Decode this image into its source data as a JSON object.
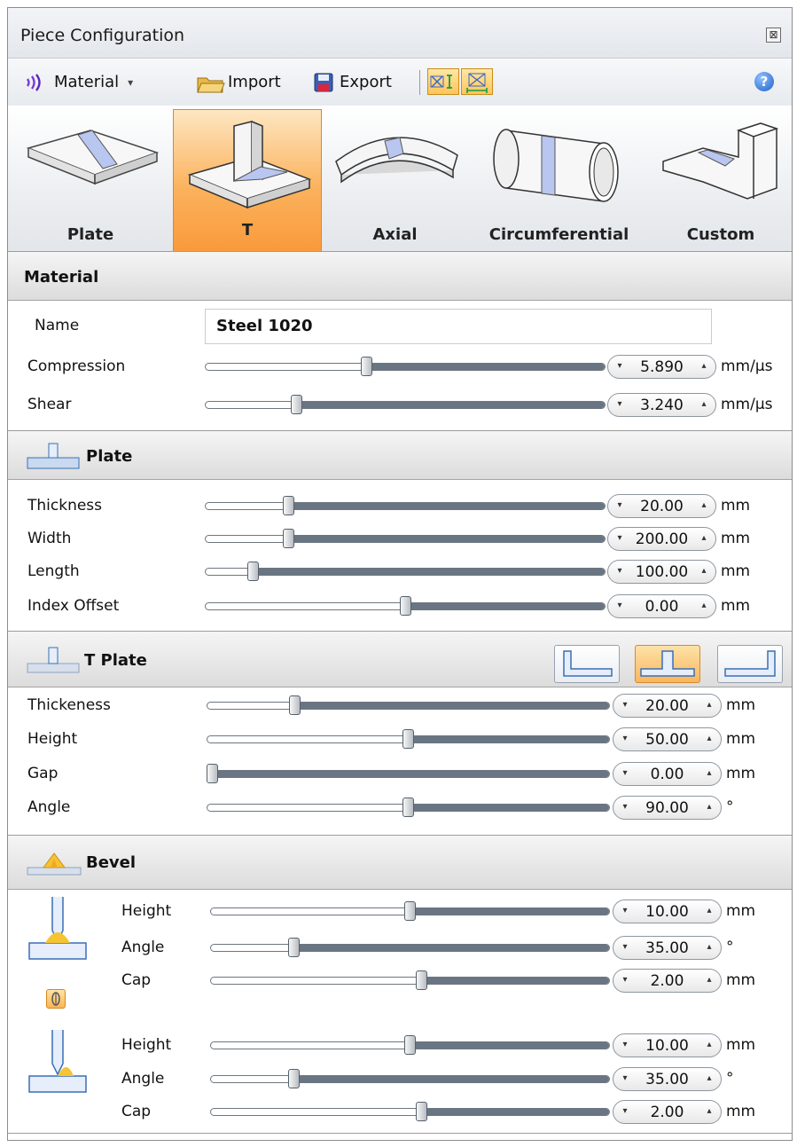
{
  "window": {
    "title": "Piece Configuration",
    "close_glyph": "⊠"
  },
  "toolbar": {
    "material_label": "Material",
    "material_arrow": "▾",
    "import_label": "Import",
    "export_label": "Export",
    "help_glyph": "?"
  },
  "gallery": {
    "selected": "T",
    "items": [
      "Plate",
      "T",
      "Axial",
      "Circumferential",
      "Custom"
    ]
  },
  "material": {
    "header": "Material",
    "name_label": "Name",
    "name_value": "Steel 1020",
    "rows": [
      {
        "label": "Compression",
        "value": "5.890",
        "unit": "mm/µs",
        "fraction": 0.4
      },
      {
        "label": "Shear",
        "value": "3.240",
        "unit": "mm/µs",
        "fraction": 0.22
      }
    ]
  },
  "plate": {
    "header": "Plate",
    "rows": [
      {
        "label": "Thickness",
        "value": "20.00",
        "unit": "mm",
        "fraction": 0.2
      },
      {
        "label": "Width",
        "value": "200.00",
        "unit": "mm",
        "fraction": 0.2
      },
      {
        "label": "Length",
        "value": "100.00",
        "unit": "mm",
        "fraction": 0.11
      },
      {
        "label": "Index Offset",
        "value": "0.00",
        "unit": "mm",
        "fraction": 0.5
      }
    ]
  },
  "tplate": {
    "header": "T Plate",
    "layout_selected": 1,
    "rows": [
      {
        "label": "Thickeness",
        "value": "20.00",
        "unit": "mm",
        "fraction": 0.21
      },
      {
        "label": "Height",
        "value": "50.00",
        "unit": "mm",
        "fraction": 0.5
      },
      {
        "label": "Gap",
        "value": "0.00",
        "unit": "mm",
        "fraction": 0.0
      },
      {
        "label": "Angle",
        "value": "90.00",
        "unit": "°",
        "fraction": 0.5
      }
    ]
  },
  "bevel": {
    "header": "Bevel",
    "group1": [
      {
        "label": "Height",
        "value": "10.00",
        "unit": "mm",
        "fraction": 0.5
      },
      {
        "label": "Angle",
        "value": "35.00",
        "unit": "°",
        "fraction": 0.2
      },
      {
        "label": "Cap",
        "value": "2.00",
        "unit": "mm",
        "fraction": 0.53
      }
    ],
    "group2": [
      {
        "label": "Height",
        "value": "10.00",
        "unit": "mm",
        "fraction": 0.5
      },
      {
        "label": "Angle",
        "value": "35.00",
        "unit": "°",
        "fraction": 0.2
      },
      {
        "label": "Cap",
        "value": "2.00",
        "unit": "mm",
        "fraction": 0.53
      }
    ]
  },
  "spin_glyphs": {
    "down": "▾",
    "up": "▴"
  },
  "colors": {
    "accent_orange": "#fbb25d",
    "slider_fill": "#697582",
    "weld_blue": "#b9c6f0"
  }
}
